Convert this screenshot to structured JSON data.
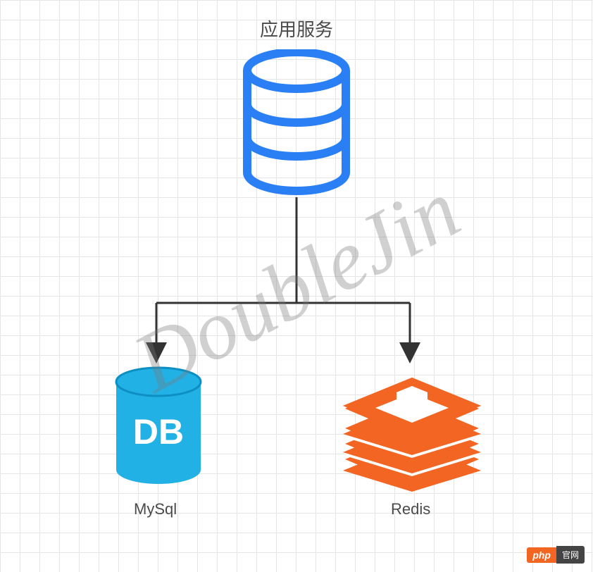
{
  "diagram": {
    "title": "应用服务",
    "nodes": {
      "app": {
        "type": "database-icon",
        "color": "#2b7ff5"
      },
      "mysql": {
        "type": "database-icon",
        "label_inside": "DB",
        "label": "MySql",
        "color": "#22b1e5"
      },
      "redis": {
        "type": "layered-diamond-icon",
        "label": "Redis",
        "color": "#f26522"
      }
    },
    "edges": [
      {
        "from": "app",
        "to": "mysql",
        "style": "orthogonal-arrow"
      },
      {
        "from": "app",
        "to": "redis",
        "style": "orthogonal-arrow"
      }
    ]
  },
  "watermark": "DoubleJin",
  "badge": {
    "left": "php",
    "right": "官网"
  }
}
